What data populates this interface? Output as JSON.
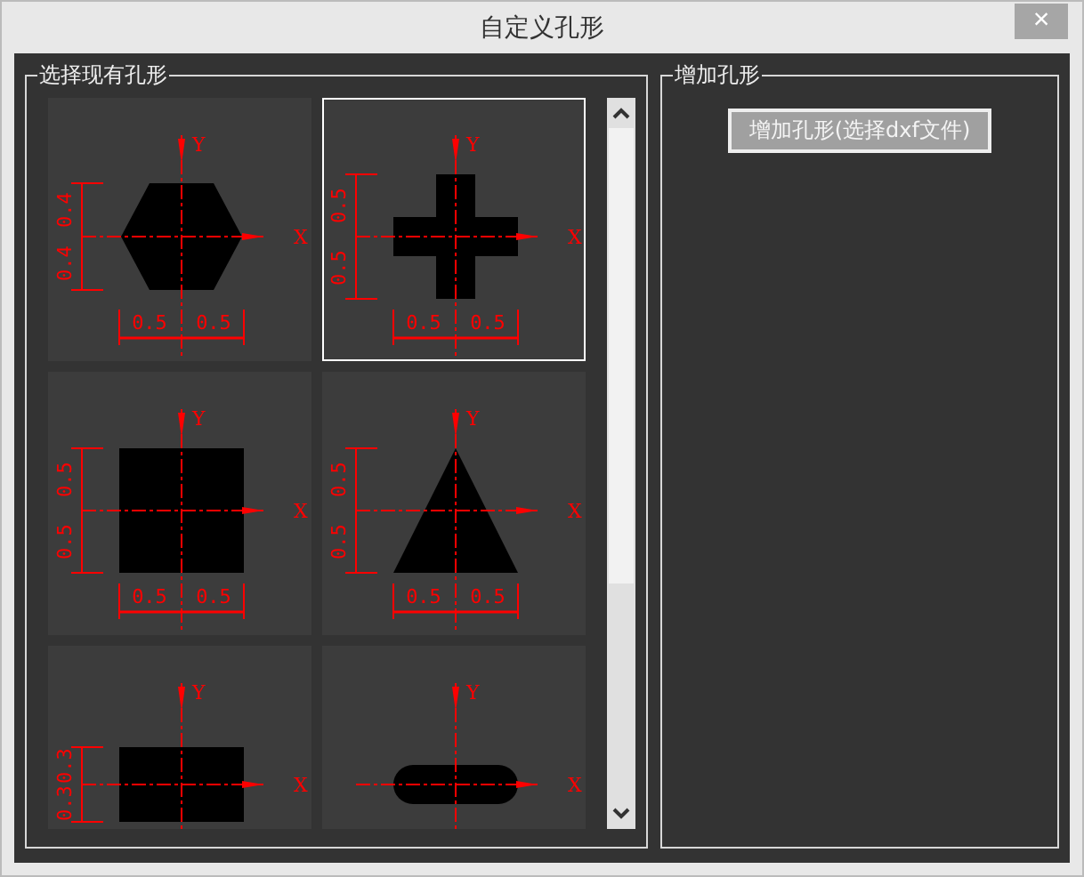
{
  "window": {
    "title": "自定义孔形",
    "close": "×"
  },
  "existing": {
    "legend": "选择现有孔形",
    "shapes": [
      {
        "kind": "hexagon",
        "selected": false,
        "axis_x": "X",
        "axis_y": "Y",
        "x_dims": [
          "0.5",
          "0.5"
        ],
        "y_dims": [
          "0.4",
          "0.4"
        ]
      },
      {
        "kind": "cross",
        "selected": true,
        "axis_x": "X",
        "axis_y": "Y",
        "x_dims": [
          "0.5",
          "0.5"
        ],
        "y_dims": [
          "0.5",
          "0.5"
        ]
      },
      {
        "kind": "square",
        "selected": false,
        "axis_x": "X",
        "axis_y": "Y",
        "x_dims": [
          "0.5",
          "0.5"
        ],
        "y_dims": [
          "0.5",
          "0.5"
        ]
      },
      {
        "kind": "triangle",
        "selected": false,
        "axis_x": "X",
        "axis_y": "Y",
        "x_dims": [
          "0.5",
          "0.5"
        ],
        "y_dims": [
          "0.5",
          "0.5"
        ]
      },
      {
        "kind": "rectangle",
        "selected": false,
        "axis_x": "X",
        "axis_y": "Y",
        "y_dims": [
          "0.3",
          "0.3"
        ]
      },
      {
        "kind": "slot",
        "selected": false,
        "axis_x": "X",
        "axis_y": "Y"
      }
    ]
  },
  "add": {
    "legend": "增加孔形",
    "button": "增加孔形(选择dxf文件)"
  }
}
